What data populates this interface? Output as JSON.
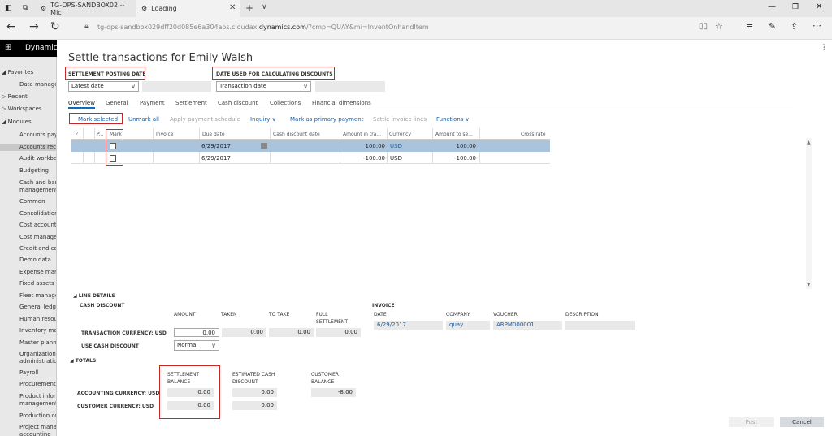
{
  "browser": {
    "tab1_title": "TG-OPS-SANDBOX02 -- Mic",
    "tab2_title": "Loading",
    "url_prefix": "tg-ops-sandbox029dff20d085e6a304aos.cloudax.",
    "url_domain": "dynamics.com",
    "url_suffix": "/?cmp=QUAY&mi=InventOnhandItem"
  },
  "app": {
    "title": "Dynamic"
  },
  "sidebar": {
    "items": [
      "◢ Favorites",
      "Data manager",
      "▷ Recent",
      "▷ Workspaces",
      "◢ Modules",
      "Accounts paya",
      "Accounts rece",
      "Audit workben",
      "Budgeting",
      "Cash and bank",
      "management",
      "Common",
      "Consolidations",
      "Cost accounti",
      "Cost managem",
      "Credit and coll",
      "Demo data",
      "Expense manag",
      "Fixed assets",
      "Fleet managem",
      "General ledger",
      "Human resour",
      "Inventory man",
      "Master plannin",
      "Organization",
      "administration",
      "Payroll",
      "Procurement a",
      "Product inform",
      "management",
      "Production co",
      "Project manag",
      "accounting"
    ]
  },
  "dialog": {
    "title": "Settle transactions for Emily Walsh",
    "help": "?",
    "posting_date_label": "SETTLEMENT POSTING DATE",
    "posting_date_value": "Latest date",
    "discount_date_label": "DATE USED FOR CALCULATING DISCOUNTS",
    "discount_date_value": "Transaction date",
    "tabs": [
      "Overview",
      "General",
      "Payment",
      "Settlement",
      "Cash discount",
      "Collections",
      "Financial dimensions"
    ],
    "actions": {
      "mark_selected": "Mark selected",
      "unmark_all": "Unmark all",
      "apply_schedule": "Apply payment schedule",
      "inquiry": "Inquiry",
      "mark_primary": "Mark as primary payment",
      "settle_invoice_lines": "Settle invoice lines",
      "functions": "Functions"
    },
    "grid": {
      "headers": {
        "check": "✓",
        "p": "P...",
        "mark": "Mark",
        "invoice": "Invoice",
        "due_date": "Due date",
        "cash_discount_date": "Cash discount date",
        "amount": "Amount in tra...",
        "currency": "Currency",
        "amount_settle": "Amount to se...",
        "cross_rate": "Cross rate"
      },
      "rows": [
        {
          "due_date": "6/29/2017",
          "amount": "100.00",
          "currency": "USD",
          "amount_settle": "100.00"
        },
        {
          "due_date": "6/29/2017",
          "amount": "-100.00",
          "currency": "USD",
          "amount_settle": "-100.00"
        }
      ]
    },
    "line_details": {
      "section": "◢ LINE DETAILS",
      "cash_discount": "CASH DISCOUNT",
      "col_amount": "AMOUNT",
      "col_taken": "TAKEN",
      "col_to_take": "TO TAKE",
      "col_full_1": "FULL",
      "col_full_2": "SETTLEMENT",
      "trans_currency_label": "TRANSACTION CURRENCY: USD",
      "amount": "0.00",
      "taken": "0.00",
      "to_take": "0.00",
      "full": "0.00",
      "use_cash_discount_label": "USE CASH DISCOUNT",
      "use_cash_discount_value": "Normal",
      "invoice_title": "INVOICE",
      "inv_date_label": "DATE",
      "inv_company_label": "COMPANY",
      "inv_voucher_label": "VOUCHER",
      "inv_description_label": "DESCRIPTION",
      "inv_date": "6/29/2017",
      "inv_company": "quay",
      "inv_voucher": "ARPM000001"
    },
    "totals": {
      "section": "◢ TOTALS",
      "col_settlement_1": "SETTLEMENT",
      "col_settlement_2": "BALANCE",
      "col_estimated_1": "ESTIMATED CASH",
      "col_estimated_2": "DISCOUNT",
      "col_customer_1": "CUSTOMER",
      "col_customer_2": "BALANCE",
      "accounting_label": "ACCOUNTING CURRENCY: USD",
      "customer_label": "CUSTOMER CURRENCY: USD",
      "acc_settlement": "0.00",
      "acc_estimated": "0.00",
      "acc_customer": "-8.00",
      "cust_settlement": "0.00",
      "cust_estimated": "0.00"
    },
    "buttons": {
      "post": "Post",
      "cancel": "Cancel"
    }
  }
}
